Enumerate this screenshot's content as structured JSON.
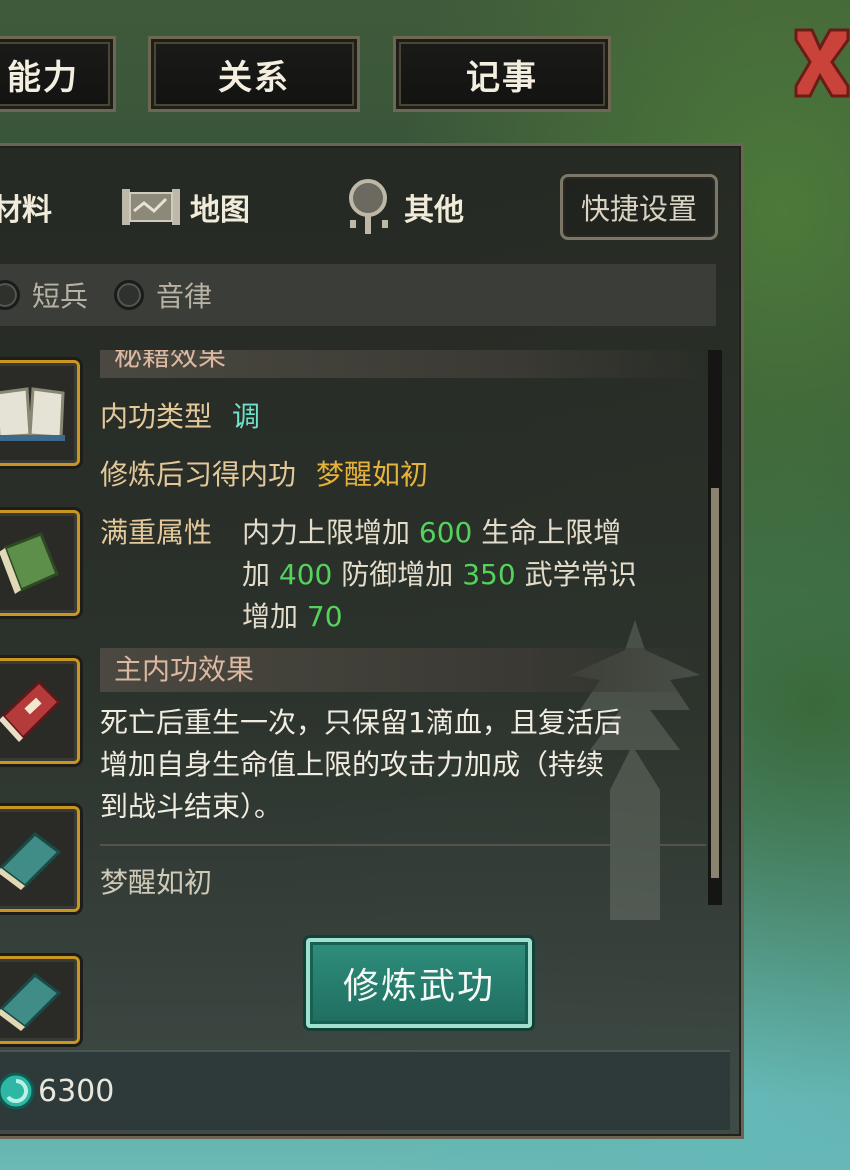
{
  "top_tabs": [
    "能力",
    "关系",
    "记事"
  ],
  "categories": [
    {
      "label": "材料",
      "icon": "scroll-icon"
    },
    {
      "label": "地图",
      "icon": "map-icon"
    },
    {
      "label": "其他",
      "icon": "magnifier-icon"
    }
  ],
  "quick_settings": "快捷设置",
  "filters": [
    "短兵",
    "音律"
  ],
  "detail": {
    "section1_title": "秘籍效果",
    "internal_type_label": "内功类型",
    "internal_type_value": "调",
    "learn_label": "修炼后习得内功",
    "learn_value": "梦醒如初",
    "full_attr_label": "满重属性",
    "attr_text1": "内力上限增加",
    "attr_val1": "600",
    "attr_text2": "生命上限增",
    "attr_text3": "加",
    "attr_val2": "400",
    "attr_text4": "防御增加",
    "attr_val3": "350",
    "attr_text5": "武学常识",
    "attr_text6": "增加",
    "attr_val4": "70",
    "section2_title": "主内功效果",
    "effect_line1": "死亡后重生一次，只保留1滴血，且复活后",
    "effect_line2": "增加自身生命值上限的攻击力加成（持续",
    "effect_line3": "到战斗结束）。",
    "skill_name": "梦醒如初"
  },
  "practice_button": "修炼武功",
  "currency": "6300",
  "colors": {
    "accent_cyan": "#6fe0c9",
    "gold": "#e5b33a",
    "green": "#53d35c",
    "slot_border": "#c9961f"
  }
}
